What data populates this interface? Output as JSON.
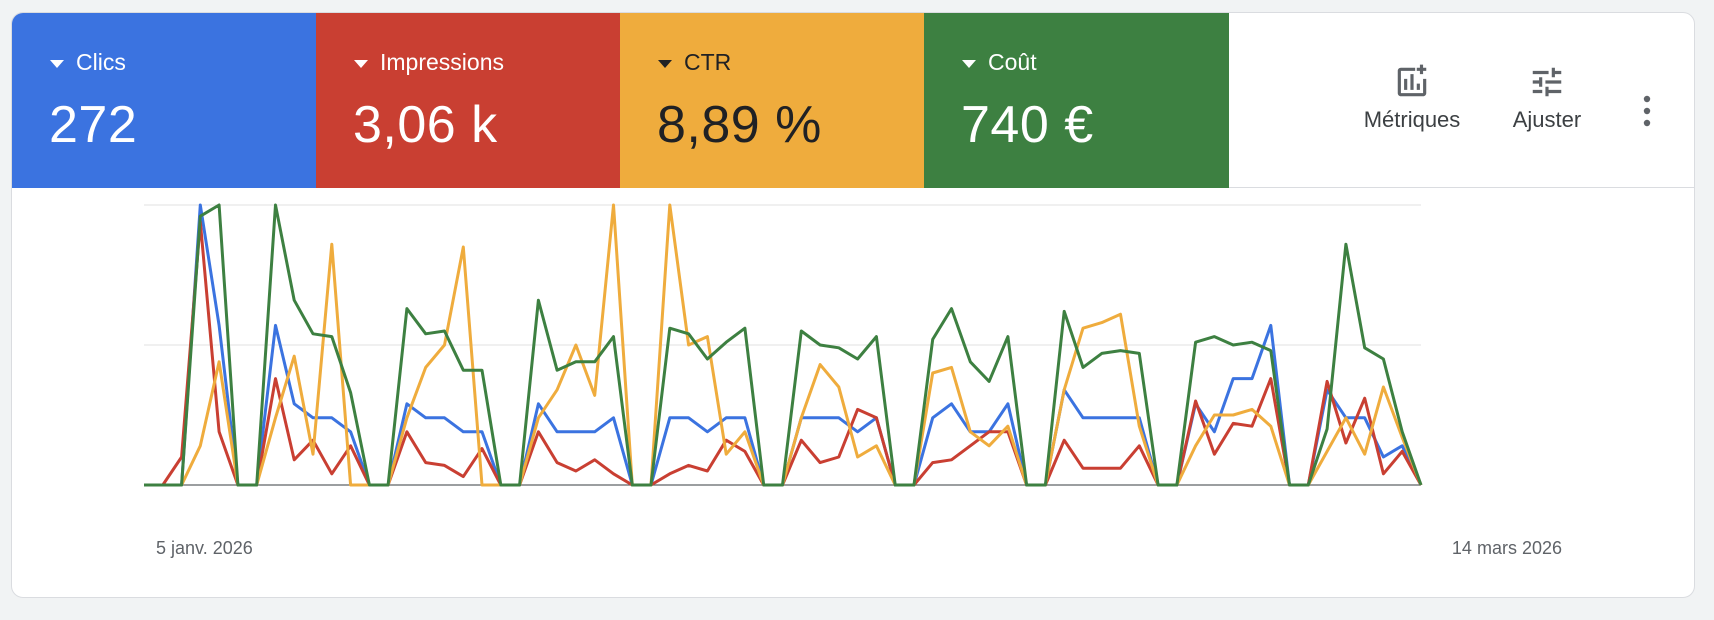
{
  "metrics": [
    {
      "label": "Clics",
      "value": "272",
      "color": "#3b73e0",
      "text_color": "#ffffff"
    },
    {
      "label": "Impressions",
      "value": "3,06 k",
      "color": "#c93f32",
      "text_color": "#ffffff"
    },
    {
      "label": "CTR",
      "value": "8,89 %",
      "color": "#efac3d",
      "text_color": "#202124"
    },
    {
      "label": "Coût",
      "value": "740 €",
      "color": "#3d8041",
      "text_color": "#ffffff"
    }
  ],
  "tools": {
    "metrics_label": "Métriques",
    "adjust_label": "Ajuster",
    "metrics_icon": "add-chart-icon",
    "adjust_icon": "tune-sliders-icon",
    "more_icon": "more-vert-icon"
  },
  "chart_data": {
    "type": "line",
    "x_start_label": "5 janv. 2026",
    "x_end_label": "14 mars 2026",
    "gridlines": 3,
    "ylim": [
      0,
      1
    ],
    "series": [
      {
        "name": "Clics",
        "color": "#3b73e0",
        "values": [
          0,
          0,
          0,
          1,
          0.57,
          0,
          0,
          0.57,
          0.29,
          0.24,
          0.24,
          0.19,
          0,
          0,
          0.29,
          0.24,
          0.24,
          0.19,
          0.19,
          0,
          0,
          0.29,
          0.19,
          0.19,
          0.19,
          0.24,
          0,
          0,
          0.24,
          0.24,
          0.19,
          0.24,
          0.24,
          0,
          0,
          0.24,
          0.24,
          0.24,
          0.19,
          0.24,
          0,
          0,
          0.24,
          0.29,
          0.19,
          0.19,
          0.29,
          0,
          0,
          0.34,
          0.24,
          0.24,
          0.24,
          0.24,
          0,
          0,
          0.29,
          0.19,
          0.38,
          0.38,
          0.57,
          0,
          0,
          0.34,
          0.24,
          0.24,
          0.1,
          0.14,
          0
        ]
      },
      {
        "name": "Impressions",
        "color": "#c93f32",
        "values": [
          0,
          0,
          0.1,
          0.94,
          0.19,
          0,
          0,
          0.38,
          0.09,
          0.16,
          0.04,
          0.14,
          0,
          0,
          0.19,
          0.08,
          0.07,
          0.03,
          0.13,
          0,
          0,
          0.19,
          0.08,
          0.05,
          0.09,
          0.04,
          0,
          0,
          0.04,
          0.07,
          0.05,
          0.16,
          0.12,
          0,
          0,
          0.16,
          0.08,
          0.1,
          0.27,
          0.24,
          0,
          0,
          0.08,
          0.09,
          0.14,
          0.19,
          0.19,
          0,
          0,
          0.16,
          0.06,
          0.06,
          0.06,
          0.14,
          0,
          0,
          0.3,
          0.11,
          0.22,
          0.21,
          0.38,
          0,
          0,
          0.37,
          0.15,
          0.31,
          0.04,
          0.12,
          0
        ]
      },
      {
        "name": "CTR",
        "color": "#efac3d",
        "values": [
          0,
          0,
          0,
          0.14,
          0.44,
          0,
          0,
          0.24,
          0.46,
          0.11,
          0.86,
          0,
          0,
          0,
          0.24,
          0.42,
          0.5,
          0.85,
          0,
          0,
          0,
          0.24,
          0.34,
          0.5,
          0.32,
          1,
          0,
          0,
          1,
          0.5,
          0.53,
          0.11,
          0.19,
          0,
          0,
          0.24,
          0.43,
          0.35,
          0.1,
          0.14,
          0,
          0,
          0.4,
          0.42,
          0.19,
          0.14,
          0.21,
          0,
          0,
          0.34,
          0.56,
          0.58,
          0.61,
          0.21,
          0,
          0,
          0.14,
          0.25,
          0.25,
          0.27,
          0.21,
          0,
          0,
          0.12,
          0.24,
          0.11,
          0.35,
          0.17,
          0
        ]
      },
      {
        "name": "Coût",
        "color": "#3d8041",
        "values": [
          0,
          0,
          0,
          0.96,
          1,
          0,
          0,
          1,
          0.66,
          0.54,
          0.53,
          0.33,
          0,
          0,
          0.63,
          0.54,
          0.55,
          0.41,
          0.41,
          0,
          0,
          0.66,
          0.41,
          0.44,
          0.44,
          0.53,
          0,
          0,
          0.56,
          0.54,
          0.45,
          0.51,
          0.56,
          0,
          0,
          0.55,
          0.5,
          0.49,
          0.45,
          0.53,
          0,
          0,
          0.52,
          0.63,
          0.44,
          0.37,
          0.53,
          0,
          0,
          0.62,
          0.42,
          0.47,
          0.48,
          0.47,
          0,
          0,
          0.51,
          0.53,
          0.5,
          0.51,
          0.48,
          0,
          0,
          0.2,
          0.86,
          0.49,
          0.45,
          0.19,
          0
        ]
      }
    ]
  }
}
